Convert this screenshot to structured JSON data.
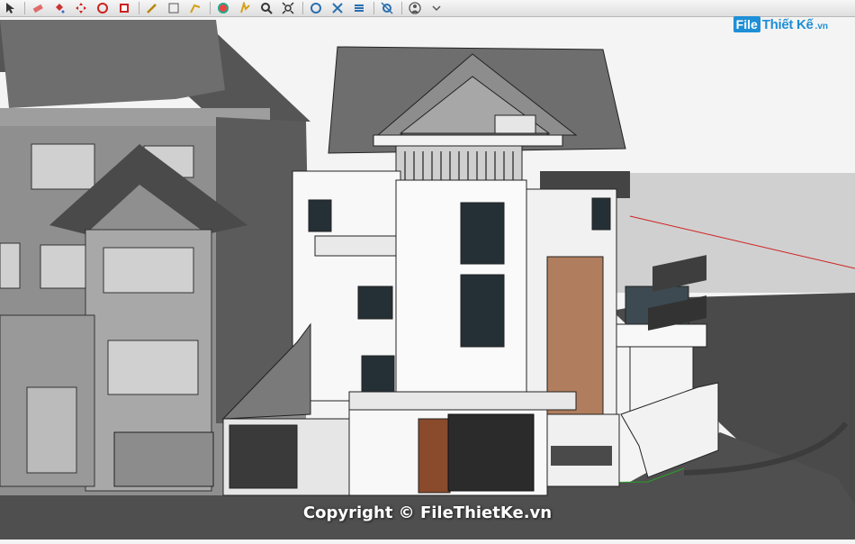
{
  "toolbar": {
    "icons": [
      "select-icon",
      "eraser-icon",
      "paint-bucket-icon",
      "move-icon",
      "rotate-icon",
      "scale-icon",
      "push-pull-icon",
      "follow-me-icon",
      "offset-icon",
      "orbit-icon",
      "pan-icon",
      "zoom-icon",
      "zoom-extents-icon",
      "section-plane-icon",
      "axes-icon",
      "tape-measure-icon",
      "protractor-icon",
      "walk-icon",
      "look-around-icon",
      "position-camera-icon"
    ]
  },
  "watermark": {
    "logo_box": "File",
    "logo_text": "Thiết Kế",
    "logo_suffix": ".vn",
    "copyright": "Copyright © FileThietKe.vn"
  },
  "colors": {
    "sky": "#f4f4f4",
    "road": "#4a4a4a",
    "ground": "#cfcfcf",
    "wall_white": "#f8f8f8",
    "roof": "#6e6e6e",
    "brick": "#b07e5e",
    "glass": "#253036",
    "axis_red": "#d02020",
    "axis_green": "#2aa02a",
    "brand_blue": "#1f8fd6"
  }
}
